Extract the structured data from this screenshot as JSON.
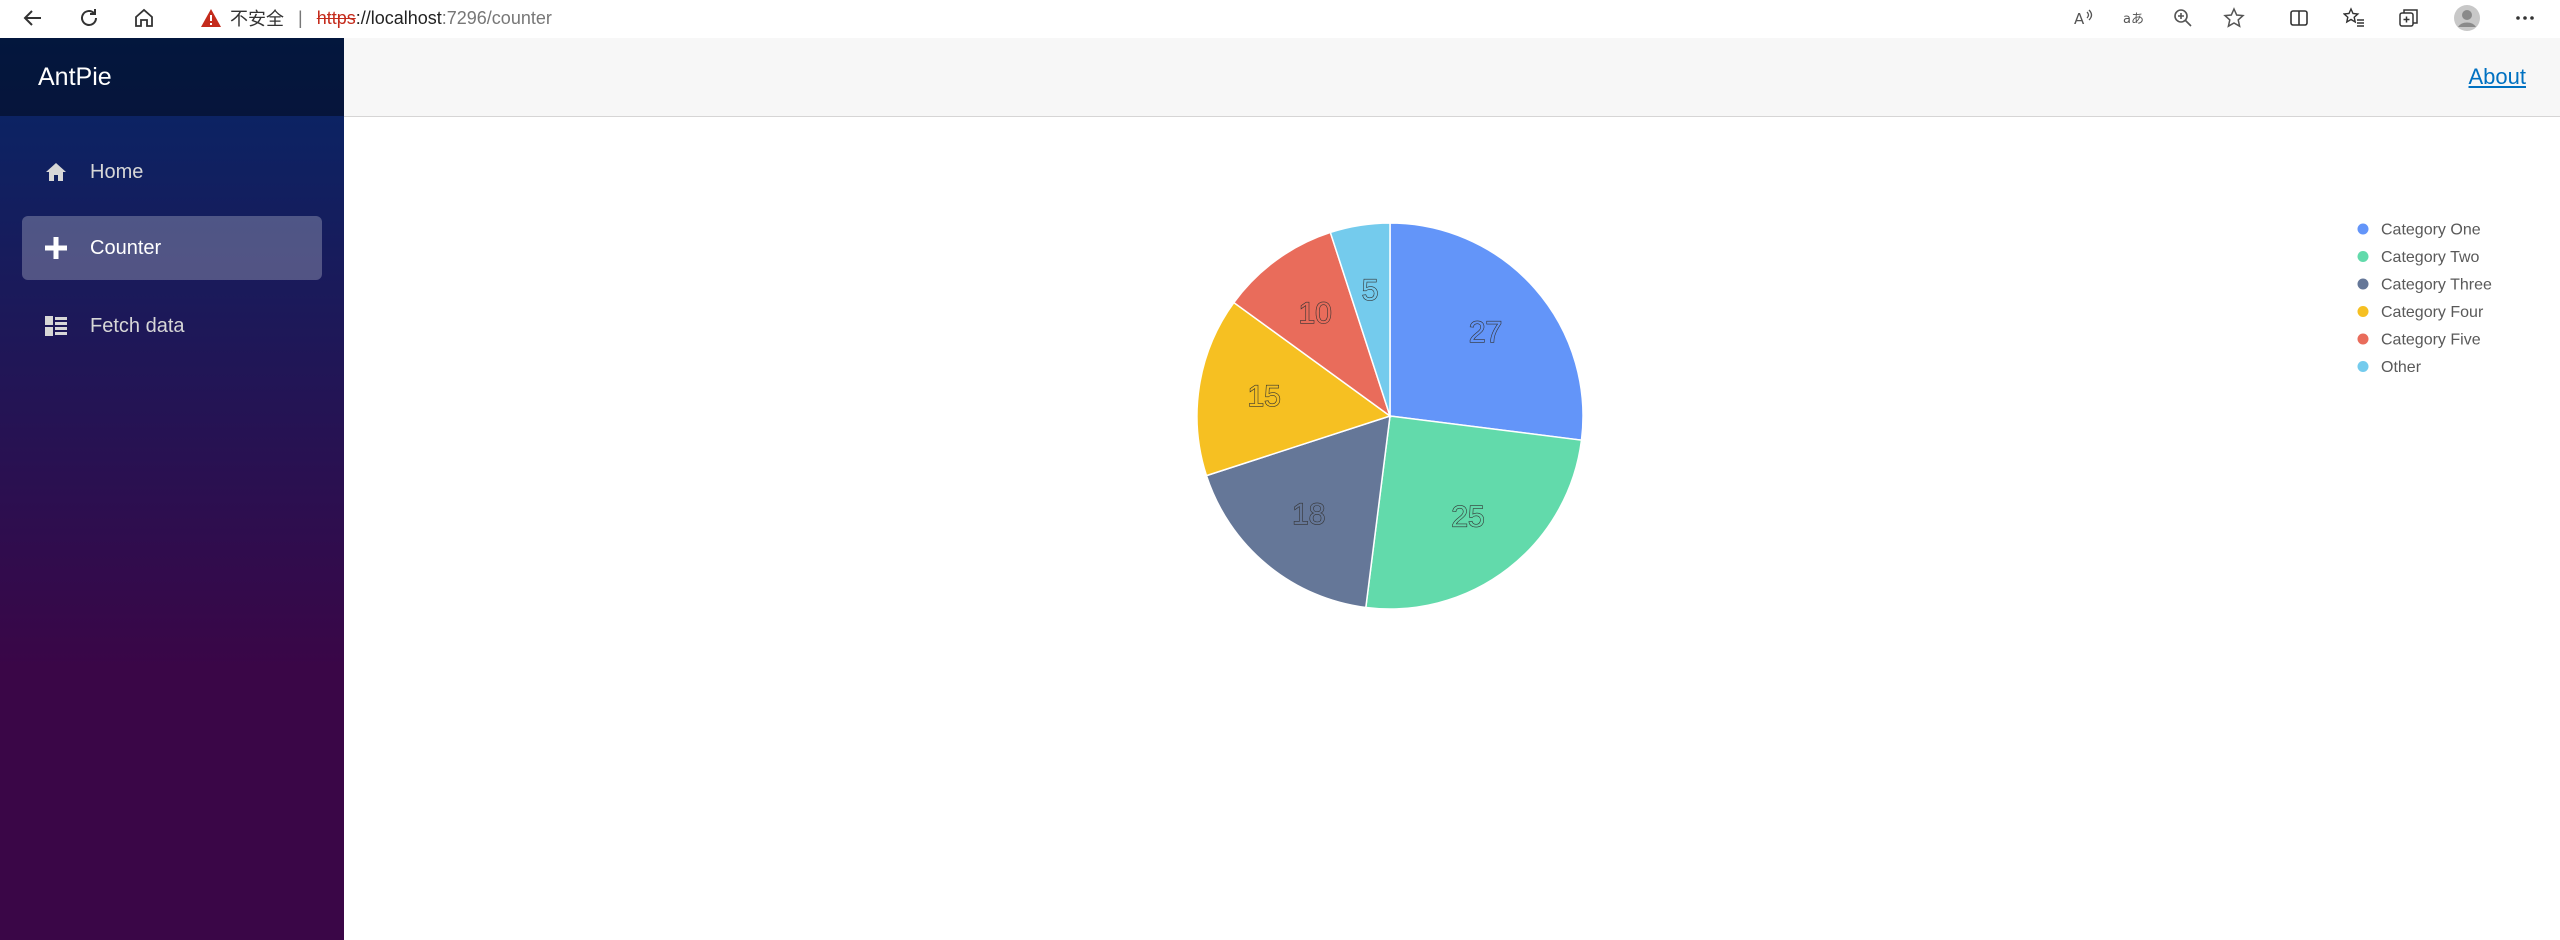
{
  "browser": {
    "security_label": "不安全",
    "url_scheme": "https",
    "url_host": "://localhost",
    "url_path": ":7296/counter"
  },
  "sidebar": {
    "brand": "AntPie",
    "items": [
      {
        "label": "Home",
        "icon": "home-icon",
        "active": false
      },
      {
        "label": "Counter",
        "icon": "plus-icon",
        "active": true
      },
      {
        "label": "Fetch data",
        "icon": "list-icon",
        "active": false
      }
    ]
  },
  "header": {
    "about_label": "About"
  },
  "colors": {
    "sidebar_top": "#052767",
    "sidebar_bottom": "#3a0647",
    "link": "#0071c1"
  },
  "chart_data": {
    "type": "pie",
    "legend_position": "right",
    "series": [
      {
        "name": "Category One",
        "value": 27,
        "color": "#6395f9"
      },
      {
        "name": "Category Two",
        "value": 25,
        "color": "#62daab"
      },
      {
        "name": "Category Three",
        "value": 18,
        "color": "#657798"
      },
      {
        "name": "Category Four",
        "value": 15,
        "color": "#f6c022"
      },
      {
        "name": "Category Five",
        "value": 10,
        "color": "#e96c5b"
      },
      {
        "name": "Other",
        "value": 5,
        "color": "#74cbed"
      }
    ]
  }
}
